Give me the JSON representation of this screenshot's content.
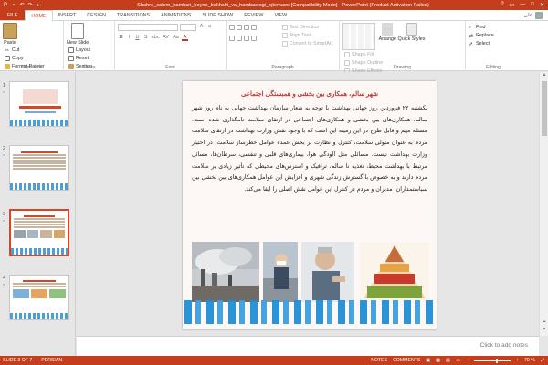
{
  "window": {
    "title": "Shahre_salem_hamkari_beyne_bakhshi_va_hambastegi_ejtemaee [Compatibility Mode] - PowerPoint (Product Activation Failed)",
    "controls": [
      "?",
      "▭",
      "—",
      "□",
      "✕"
    ]
  },
  "tabs": [
    "FILE",
    "HOME",
    "INSERT",
    "DESIGN",
    "TRANSITIONS",
    "ANIMATIONS",
    "SLIDE SHOW",
    "REVIEW",
    "VIEW"
  ],
  "active_tab": "HOME",
  "user": "علی",
  "ribbon": {
    "clipboard": {
      "paste": "Paste",
      "cut": "Cut",
      "copy": "Copy",
      "format_painter": "Format Painter",
      "label": "Clipboard"
    },
    "slides": {
      "new_slide": "New Slide",
      "layout": "Layout",
      "reset": "Reset",
      "section": "Section",
      "label": "Slides"
    },
    "font": {
      "label": "Font",
      "buttons": [
        "B",
        "I",
        "U",
        "S",
        "abc",
        "AV",
        "Aa",
        "A"
      ]
    },
    "paragraph": {
      "text_direction": "Text Direction",
      "align_text": "Align Text",
      "convert_smartart": "Convert to SmartArt",
      "label": "Paragraph"
    },
    "drawing": {
      "arrange": "Arrange",
      "quick_styles": "Quick Styles",
      "shape_fill": "Shape Fill",
      "shape_outline": "Shape Outline",
      "shape_effects": "Shape Effects",
      "label": "Drawing"
    },
    "editing": {
      "find": "Find",
      "replace": "Replace",
      "select": "Select",
      "label": "Editing"
    }
  },
  "thumbnails": [
    {
      "num": "1",
      "star": "*"
    },
    {
      "num": "2",
      "star": "*"
    },
    {
      "num": "3",
      "star": "*",
      "selected": true
    },
    {
      "num": "4",
      "star": "*"
    }
  ],
  "slide": {
    "title": "شهر سالم، همکاری بین بخشی و همبستگی اجتماعی",
    "body": "یکشنبه ۲۲ فروردین روز جهانی بهداشت با توجه به شعار سازمان بهداشت جهانی به نام روز شهر سالم، همکاری‌های بین بخشی و همکاری‌های اجتماعی در ارتقای سلامت نامگذاری شده است. مسئله مهم و قابل طرح در این زمینه این است که با وجود نقش وزارت بهداشت در ارتقای سلامت مردم به عنوان متولی سلامت، کنترل و نظارت بر بخش عمده عوامل خطرساز سلامت، در اختیار وزارت بهداشت نیست. مسائلی مثل آلودگی هوا، بیماری‌های قلبی و تنفسی، سرطان‌ها، مسائل مرتبط با بهداشت محیط، تغذیه نا سالم، ترافیک و استرس‌های محیطی که تأثیر زیادی بر سلامت مردم دارند و به خصوص با گسترش زندگی شهری و افزایش این عوامل همکاری‌های بین بخشی بین سیاستمداران، مدیران و مردم در کنترل این عوامل نقش اصلی را ایفا می‌کند."
  },
  "notes_placeholder": "Click to add notes",
  "status": {
    "slide_pos": "SLIDE 3 OF 7",
    "language": "PERSIAN",
    "notes": "NOTES",
    "comments": "COMMENTS",
    "zoom": "70 %"
  },
  "colors": {
    "accent": "#c43e1c",
    "title_red": "#c0392b"
  }
}
